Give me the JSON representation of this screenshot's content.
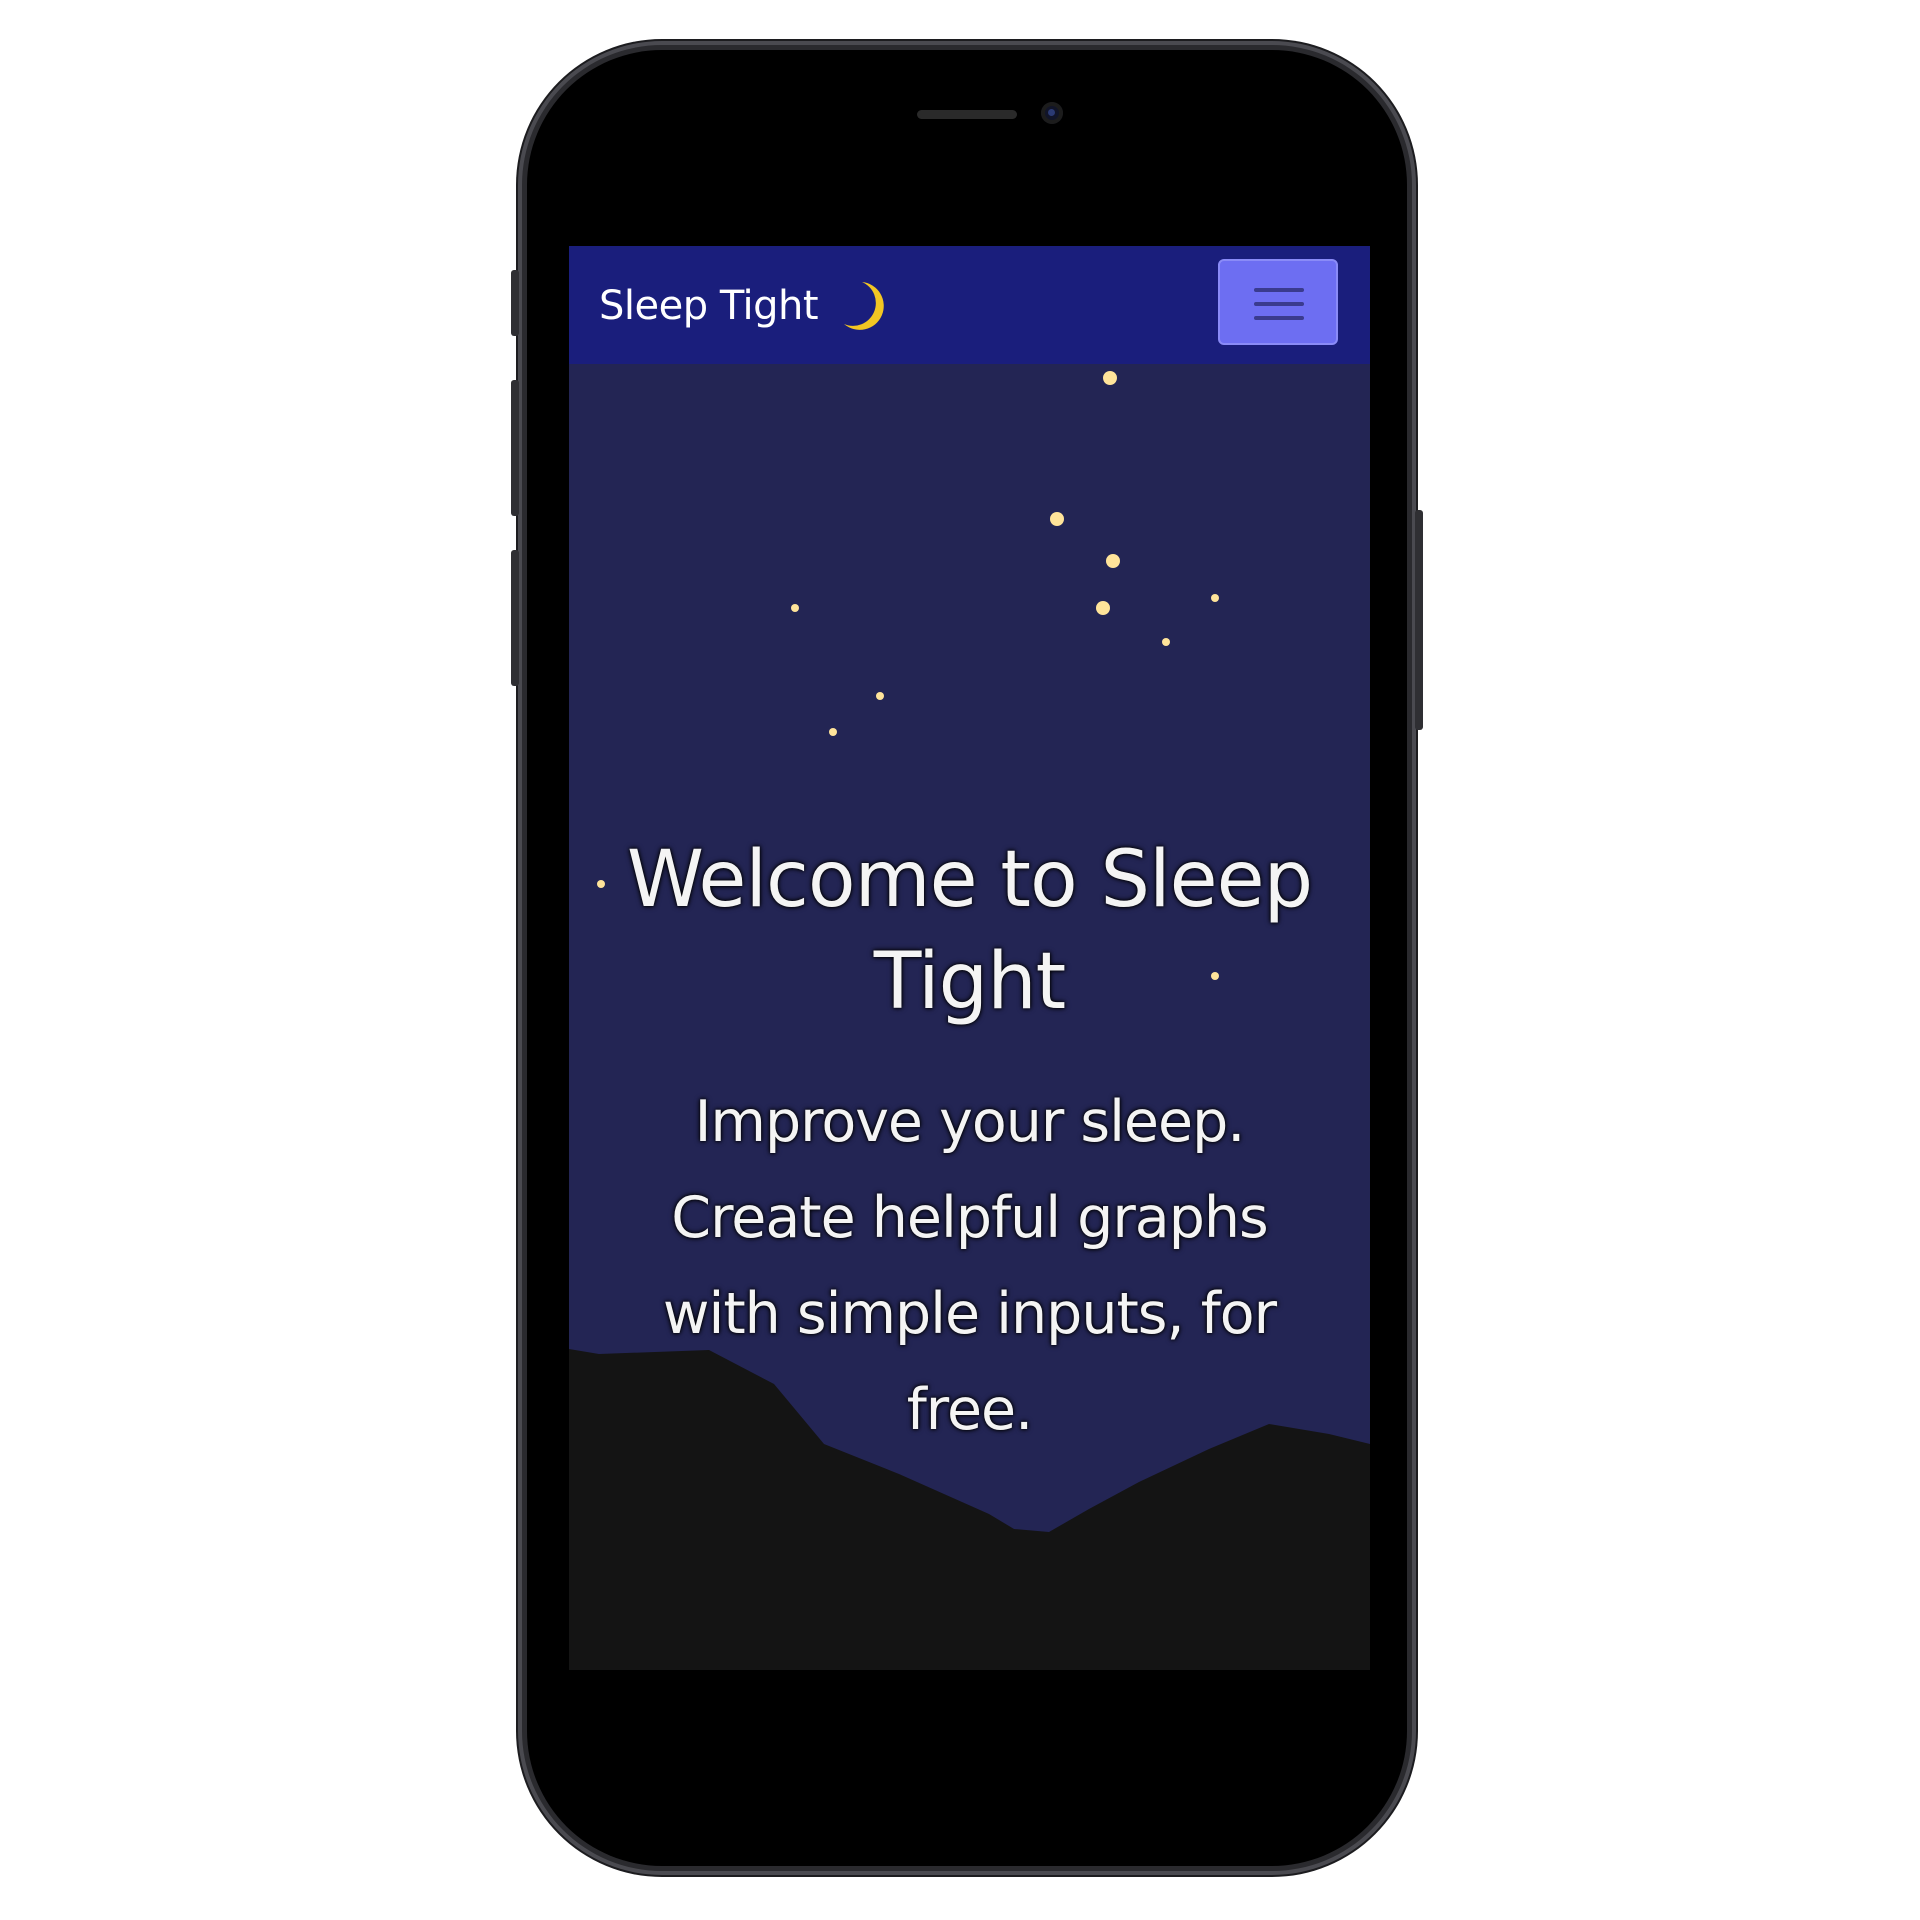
{
  "navbar": {
    "brand": "Sleep Tight",
    "brand_icon": "crescent-moon-icon",
    "menu_icon": "hamburger-menu-icon",
    "background": "#1a1e7c",
    "menu_button_color": "#6d6ef2"
  },
  "hero": {
    "title": "Welcome to Sleep Tight",
    "subtitle": "Improve your sleep. Create helpful graphs with simple inputs, for free.",
    "sky_color": "#232554",
    "moon_color": "#ffe49a",
    "star_color": "#ffe49a",
    "mountain_color": "#141414"
  }
}
